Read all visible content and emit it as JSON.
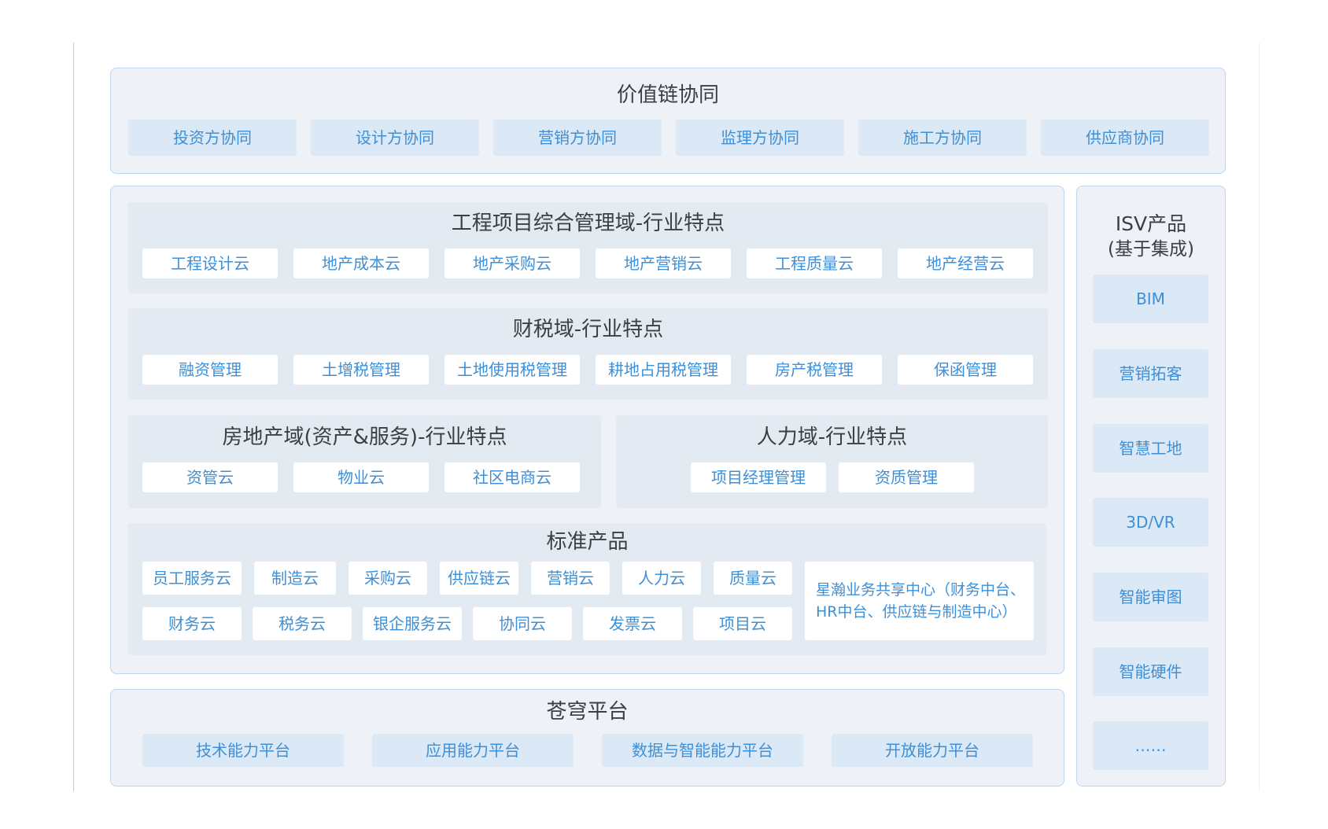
{
  "value_chain": {
    "title": "价值链协同",
    "items": [
      "投资方协同",
      "设计方协同",
      "营销方协同",
      "监理方协同",
      "施工方协同",
      "供应商协同"
    ]
  },
  "engineering": {
    "title": "工程项目综合管理域-行业特点",
    "items": [
      "工程设计云",
      "地产成本云",
      "地产采购云",
      "地产营销云",
      "工程质量云",
      "地产经营云"
    ]
  },
  "finance_tax": {
    "title": "财税域-行业特点",
    "items": [
      "融资管理",
      "土增税管理",
      "土地使用税管理",
      "耕地占用税管理",
      "房产税管理",
      "保函管理"
    ]
  },
  "real_estate": {
    "title": "房地产域(资产&服务)-行业特点",
    "items": [
      "资管云",
      "物业云",
      "社区电商云"
    ]
  },
  "hr": {
    "title": "人力域-行业特点",
    "items": [
      "项目经理管理",
      "资质管理"
    ]
  },
  "standard": {
    "title": "标准产品",
    "row1": [
      "员工服务云",
      "制造云",
      "采购云",
      "供应链云",
      "营销云",
      "人力云",
      "质量云"
    ],
    "row2": [
      "财务云",
      "税务云",
      "银企服务云",
      "协同云",
      "发票云",
      "项目云"
    ],
    "shared_center_line1": "星瀚业务共享中心（财务中台、",
    "shared_center_line2": "HR中台、供应链与制造中心）"
  },
  "platform": {
    "title": "苍穹平台",
    "items": [
      "技术能力平台",
      "应用能力平台",
      "数据与智能能力平台",
      "开放能力平台"
    ]
  },
  "isv": {
    "title_line1": "ISV产品",
    "title_line2": "(基于集成)",
    "items": [
      "BIM",
      "营销拓客",
      "智慧工地",
      "3D/VR",
      "智能审图",
      "智能硬件",
      "……"
    ]
  },
  "colors": {
    "panel_bg": "#eef2f7",
    "panel_border": "#bcd7ee",
    "section_bg": "#e4eaf2",
    "chip_blue": "#dbe8f6",
    "chip_text": "#3e8fd6",
    "title_text": "#3b3f45"
  }
}
